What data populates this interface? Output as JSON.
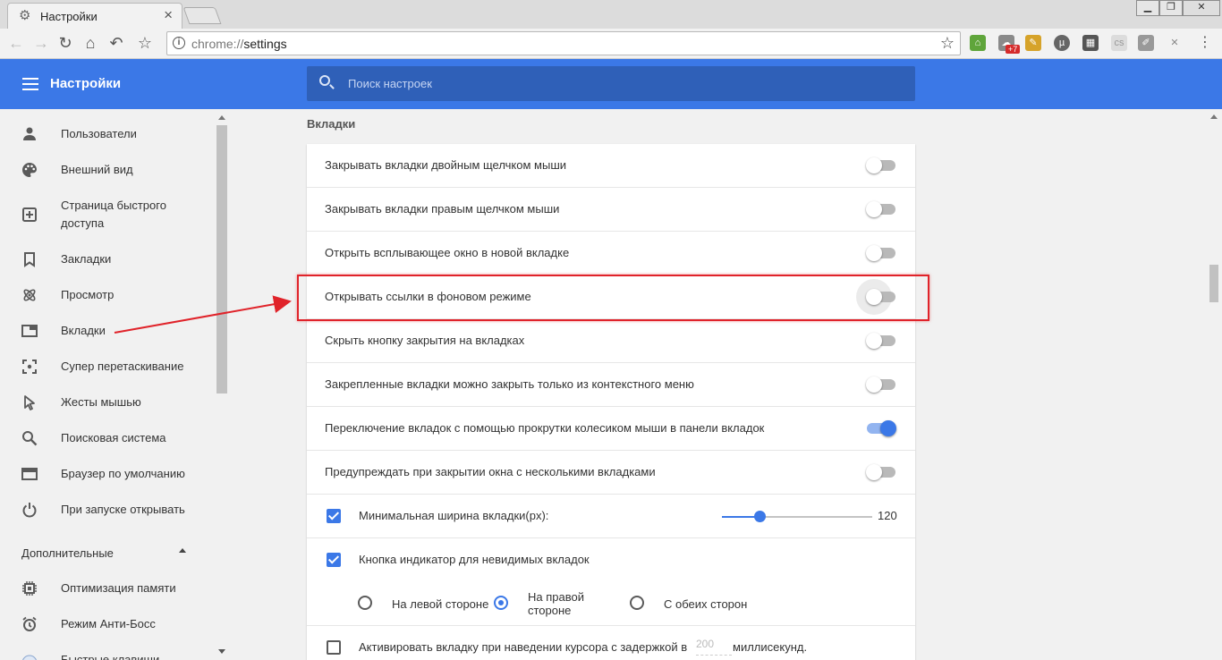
{
  "browser": {
    "tab_title": "Настройки",
    "tab_close": "×",
    "url_scheme": "chrome://",
    "url_path": "settings",
    "ext_badge": "+7"
  },
  "header": {
    "title": "Настройки",
    "search_placeholder": "Поиск настроек"
  },
  "sidebar": {
    "items": [
      {
        "label": "Пользователи",
        "icon": "person-icon"
      },
      {
        "label": "Внешний вид",
        "icon": "palette-icon"
      },
      {
        "label": "Страница быстрого доступа",
        "icon": "speed-dial-icon"
      },
      {
        "label": "Закладки",
        "icon": "bookmark-icon"
      },
      {
        "label": "Просмотр",
        "icon": "atom-icon"
      },
      {
        "label": "Вкладки",
        "icon": "tab-icon"
      },
      {
        "label": "Супер перетаскивание",
        "icon": "drag-target-icon"
      },
      {
        "label": "Жесты мышью",
        "icon": "cursor-icon"
      },
      {
        "label": "Поисковая система",
        "icon": "search-icon"
      },
      {
        "label": "Браузер по умолчанию",
        "icon": "browser-window-icon"
      },
      {
        "label": "При запуске открывать",
        "icon": "power-icon"
      }
    ],
    "advanced_label": "Дополнительные",
    "advanced_items": [
      {
        "label": "Оптимизация памяти",
        "icon": "chip-icon"
      },
      {
        "label": "Режим Анти-Босс",
        "icon": "alarm-icon"
      },
      {
        "label": "Быстрые клавиши",
        "icon": "keyboard-icon"
      }
    ]
  },
  "main": {
    "section_title": "Вкладки",
    "toggles": [
      {
        "label": "Закрывать вкладки двойным щелчком мыши",
        "on": false
      },
      {
        "label": "Закрывать вкладки правым щелчком мыши",
        "on": false
      },
      {
        "label": "Открыть всплывающее окно в новой вкладке",
        "on": false
      },
      {
        "label": "Открывать ссылки в фоновом режиме",
        "on": false
      },
      {
        "label": "Скрыть кнопку закрытия на вкладках",
        "on": false
      },
      {
        "label": "Закрепленные вкладки можно закрыть только из контекстного меню",
        "on": false
      },
      {
        "label": "Переключение вкладок с помощью прокрутки колесиком мыши в панели вкладок",
        "on": true
      },
      {
        "label": "Предупреждать при закрытии окна с несколькими вкладками",
        "on": false
      }
    ],
    "min_width": {
      "label": "Минимальная ширина вкладки(px):",
      "checked": true,
      "value": "120"
    },
    "indicator": {
      "label": "Кнопка индикатор для невидимых вкладок",
      "checked": true,
      "options": [
        "На левой стороне",
        "На правой стороне",
        "С обеих сторон"
      ],
      "selected": "На правой стороне"
    },
    "hover_activate": {
      "label": "Активировать вкладку при наведении курсора с задержкой в",
      "value": "200",
      "suffix": "миллисекунд.",
      "checked": false
    }
  }
}
